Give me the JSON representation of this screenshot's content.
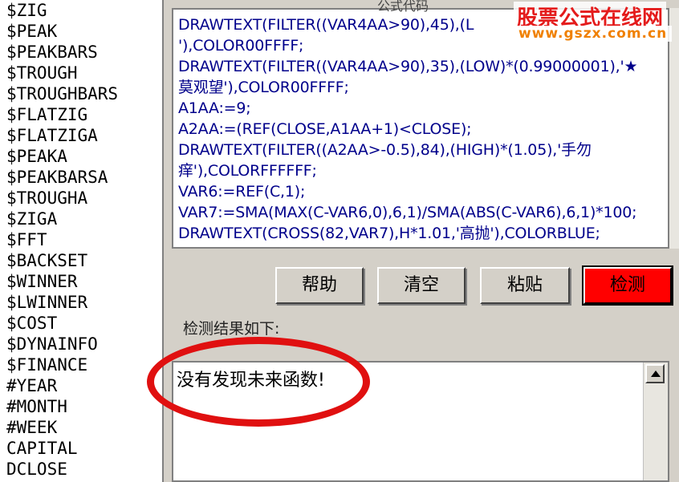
{
  "function_list": [
    "$ZIG",
    "$PEAK",
    "$PEAKBARS",
    "$TROUGH",
    "$TROUGHBARS",
    "$FLATZIG",
    "$FLATZIGA",
    "$PEAKA",
    "$PEAKBARSA",
    "$TROUGHA",
    "$ZIGA",
    "$FFT",
    "$BACKSET",
    "$WINNER",
    "$LWINNER",
    "$COST",
    "$DYNAINFO",
    "$FINANCE",
    "#YEAR",
    "#MONTH",
    "#WEEK",
    "CAPITAL",
    "DCLOSE"
  ],
  "code_editor": {
    "header": "公式代码",
    "lines": [
      "DRAWTEXT(FILTER((VAR4AA>90),45),(L",
      "'),COLOR00FFFF;",
      "DRAWTEXT(FILTER((VAR4AA>90),35),(LOW)*(0.99000001),'★",
      "莫观望'),COLOR00FFFF;",
      "A1AA:=9;",
      "A2AA:=(REF(CLOSE,A1AA+1)<CLOSE);",
      "DRAWTEXT(FILTER((A2AA>-0.5),84),(HIGH)*(1.05),'手勿",
      "痒'),COLORFFFFFF;",
      "VAR6:=REF(C,1);",
      "VAR7:=SMA(MAX(C-VAR6,0),6,1)/SMA(ABS(C-VAR6),6,1)*100;",
      "DRAWTEXT(CROSS(82,VAR7),H*1.01,'高抛'),COLORBLUE;"
    ]
  },
  "buttons": {
    "help": "帮助",
    "clear": "清空",
    "paste": "粘贴",
    "check": "检测"
  },
  "result": {
    "label": "检测结果如下:",
    "text": "没有发现未来函数!"
  },
  "watermark": {
    "site_name": "股票公式在线网",
    "url": "www.gszx.com.cn"
  },
  "colors": {
    "code_text": "#00008b",
    "check_button": "#ff0000",
    "highlight": "#e01010"
  }
}
